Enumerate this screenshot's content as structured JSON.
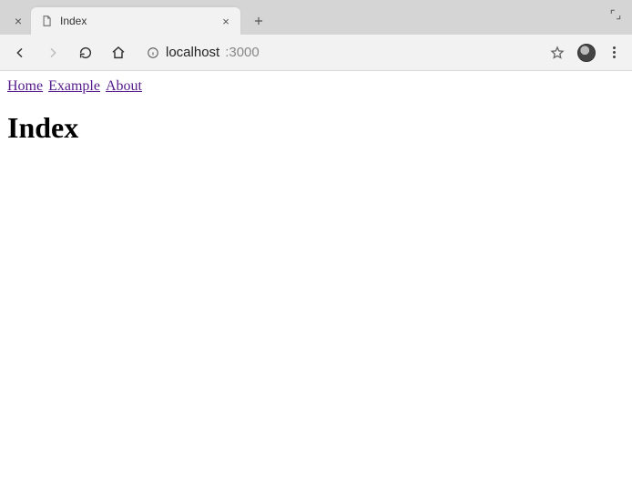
{
  "browser": {
    "tab_title": "Index",
    "url_host": "localhost",
    "url_port": ":3000"
  },
  "nav": {
    "links": [
      "Home",
      "Example",
      "About"
    ]
  },
  "page": {
    "heading": "Index"
  }
}
